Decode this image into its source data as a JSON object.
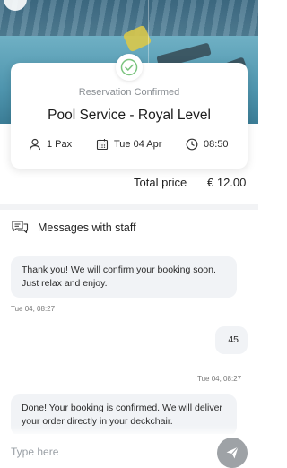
{
  "reservation": {
    "status": "Reservation Confirmed",
    "title": "Pool Service - Royal Level",
    "pax": "1 Pax",
    "date": "Tue 04 Apr",
    "time": "08:50"
  },
  "total": {
    "label": "Total price",
    "value": "€ 12.00"
  },
  "messages_header": "Messages with staff",
  "messages": [
    {
      "text": "Thank you! We will confirm your booking soon. Just relax and enjoy.",
      "time": "Tue 04, 08:27"
    },
    {
      "text": "45",
      "time": "Tue 04, 08:27"
    },
    {
      "text": "Done! Your booking is confirmed. We will deliver your order directly in your deckchair."
    }
  ],
  "composer": {
    "placeholder": "Type here"
  },
  "colors": {
    "accent_green": "#7bc47f",
    "bubble_bg": "#f1f3f6",
    "send_button": "#9ea2a6"
  }
}
